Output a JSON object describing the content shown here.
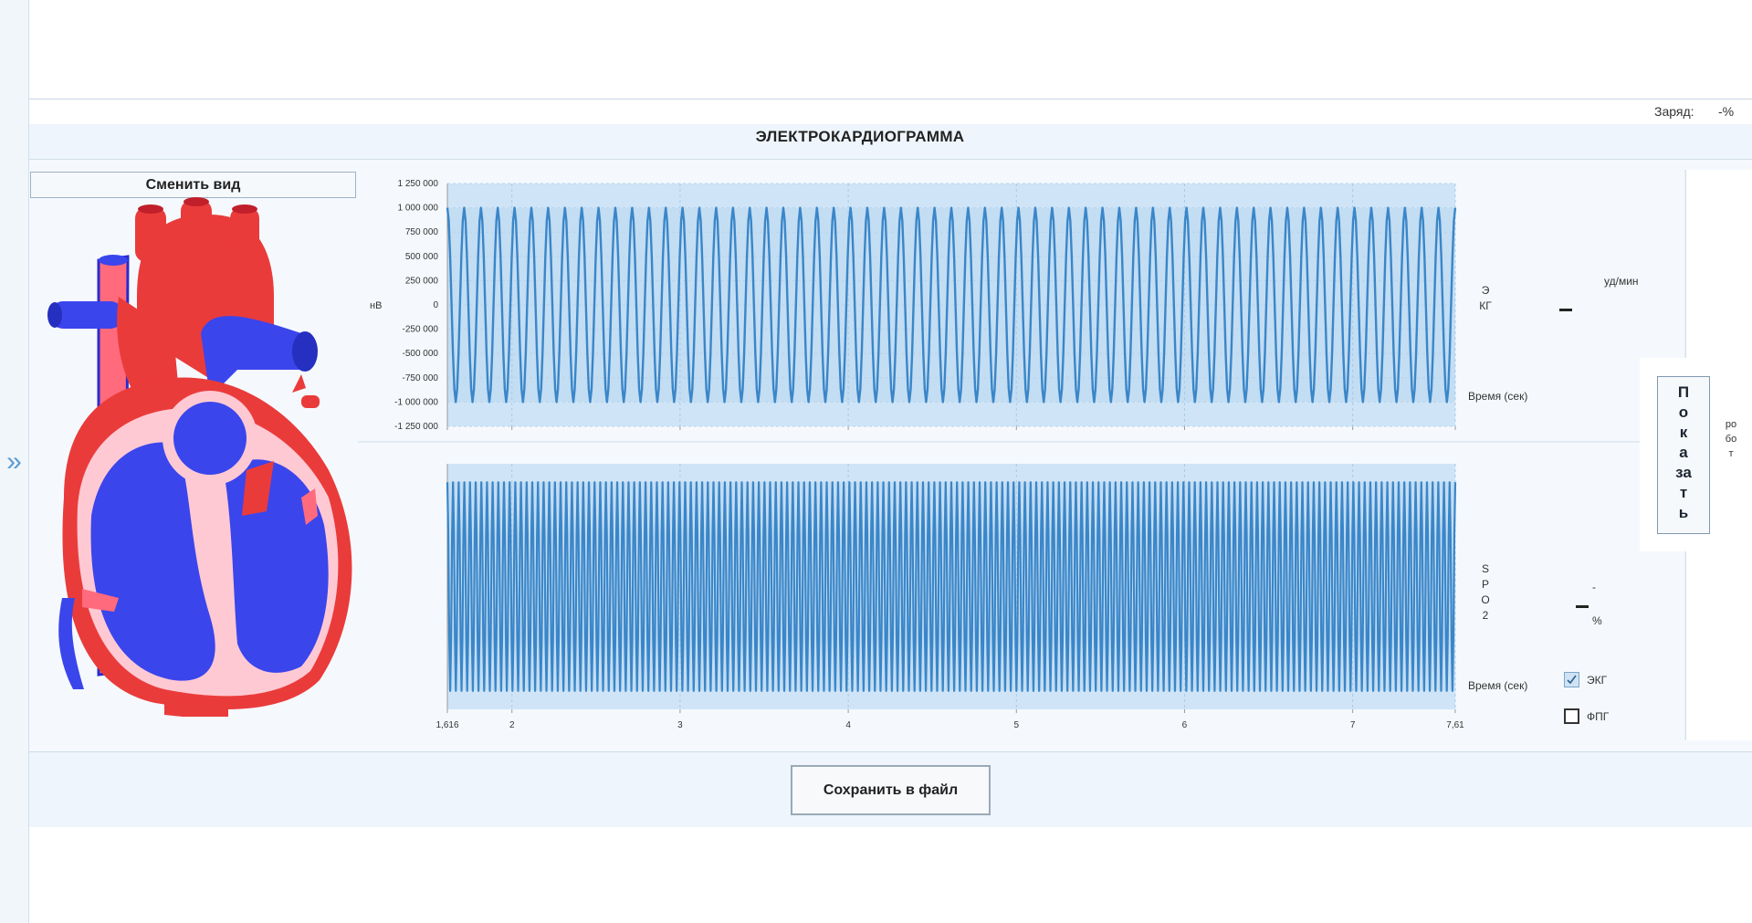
{
  "header": {
    "charge_label": "Заряд:",
    "charge_value": "-%",
    "title": "ЭЛЕКТРОКАРДИОГРАММА"
  },
  "sidebar": {
    "expand_icon": "double-chevron-right-icon"
  },
  "left_panel": {
    "change_view_button": "Сменить вид",
    "heart_illustration": "heart-anatomy-illustration"
  },
  "ecg_panel": {
    "vertical_label": "ЭКГ",
    "rate_unit": "уд/мин",
    "rate_value": "–"
  },
  "spo2_panel": {
    "vertical_label": "SPO2",
    "value_top": "-",
    "value_main": "–",
    "unit": "%"
  },
  "side_panel": {
    "show_button": "Показать",
    "vertical_label": "робот"
  },
  "checkboxes": [
    {
      "label": "ЭКГ",
      "checked": true
    },
    {
      "label": "ФПГ",
      "checked": false
    }
  ],
  "footer": {
    "save_button": "Сохранить в файл"
  },
  "colors": {
    "series": "#3a86c8",
    "plot_bg": "#cfe5f7",
    "heart_red": "#ea3b3b",
    "heart_blue": "#3b45ec",
    "heart_pink": "#ffc9d3"
  },
  "chart_data": [
    {
      "type": "line",
      "title": "",
      "ylabel": "нВ",
      "xlabel": "Время (сек)",
      "ylim": [
        -1250000,
        1250000
      ],
      "yticks": [
        1250000,
        1000000,
        750000,
        500000,
        250000,
        0,
        -250000,
        -500000,
        -750000,
        -1000000,
        -1250000
      ],
      "ytick_labels": [
        "1 250 000",
        "1 000 000",
        "750 000",
        "500 000",
        "250 000",
        "0",
        "-250 000",
        "-500 000",
        "-750 000",
        "-1 000 000",
        "-1 250 000"
      ],
      "xlim": [
        1.616,
        7.61
      ],
      "xticks": [
        1.616,
        2,
        3,
        4,
        5,
        6,
        7,
        7.61
      ],
      "xtick_labels": [
        "1,616",
        "2",
        "3",
        "4",
        "5",
        "6",
        "7",
        "7,61"
      ],
      "series": [
        {
          "signal": "sine",
          "amplitude": 1000000,
          "cycles": 60,
          "samples_per_cycle": 12
        }
      ]
    },
    {
      "type": "line",
      "title": "",
      "ylabel": "",
      "xlabel": "Время (сек)",
      "ylim": [
        -1,
        1
      ],
      "xlim": [
        1.616,
        7.61
      ],
      "xticks": [
        1.616,
        2,
        3,
        4,
        5,
        6,
        7,
        7.61
      ],
      "xtick_labels": [
        "1,616",
        "2",
        "3",
        "4",
        "5",
        "6",
        "7",
        "7,61"
      ],
      "series": [
        {
          "signal": "sine",
          "amplitude": 0.85,
          "cycles": 178,
          "samples_per_cycle": 6
        }
      ]
    }
  ]
}
